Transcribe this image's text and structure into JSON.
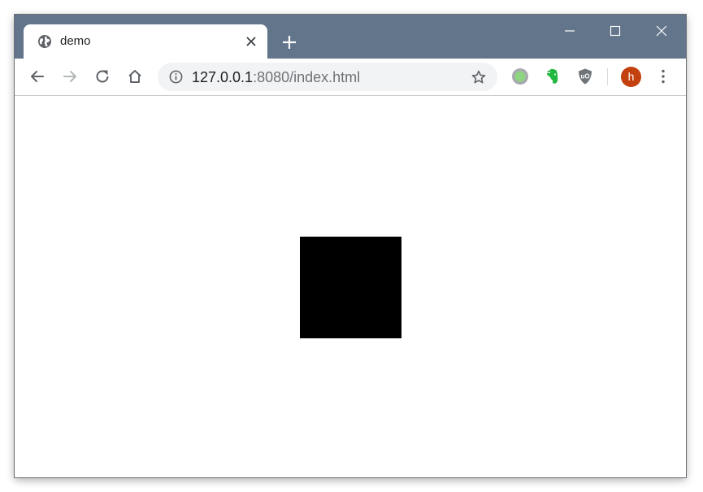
{
  "browser": {
    "tab": {
      "title": "demo",
      "favicon_icon": "globe-icon",
      "close_icon": "close-icon"
    },
    "new_tab_icon": "plus-icon",
    "window_controls": [
      "minimize-icon",
      "maximize-icon",
      "close-icon"
    ],
    "toolbar": {
      "back_icon": "arrow-left-icon",
      "forward_icon": "arrow-right-icon",
      "reload_icon": "reload-icon",
      "home_icon": "home-icon"
    },
    "omnibox": {
      "info_icon": "info-icon",
      "url_host": "127.0.0.1",
      "url_rest": ":8080/index.html",
      "bookmark_icon": "star-icon"
    },
    "extensions": [
      "circle-extension-icon",
      "evernote-icon",
      "ublock-icon"
    ],
    "profile": {
      "initial": "h",
      "color": "#c2410f"
    },
    "menu_icon": "vertical-dots-icon"
  },
  "colors": {
    "titlebar": "#63758b",
    "page_background": "#ffffff",
    "square": "#000000"
  }
}
